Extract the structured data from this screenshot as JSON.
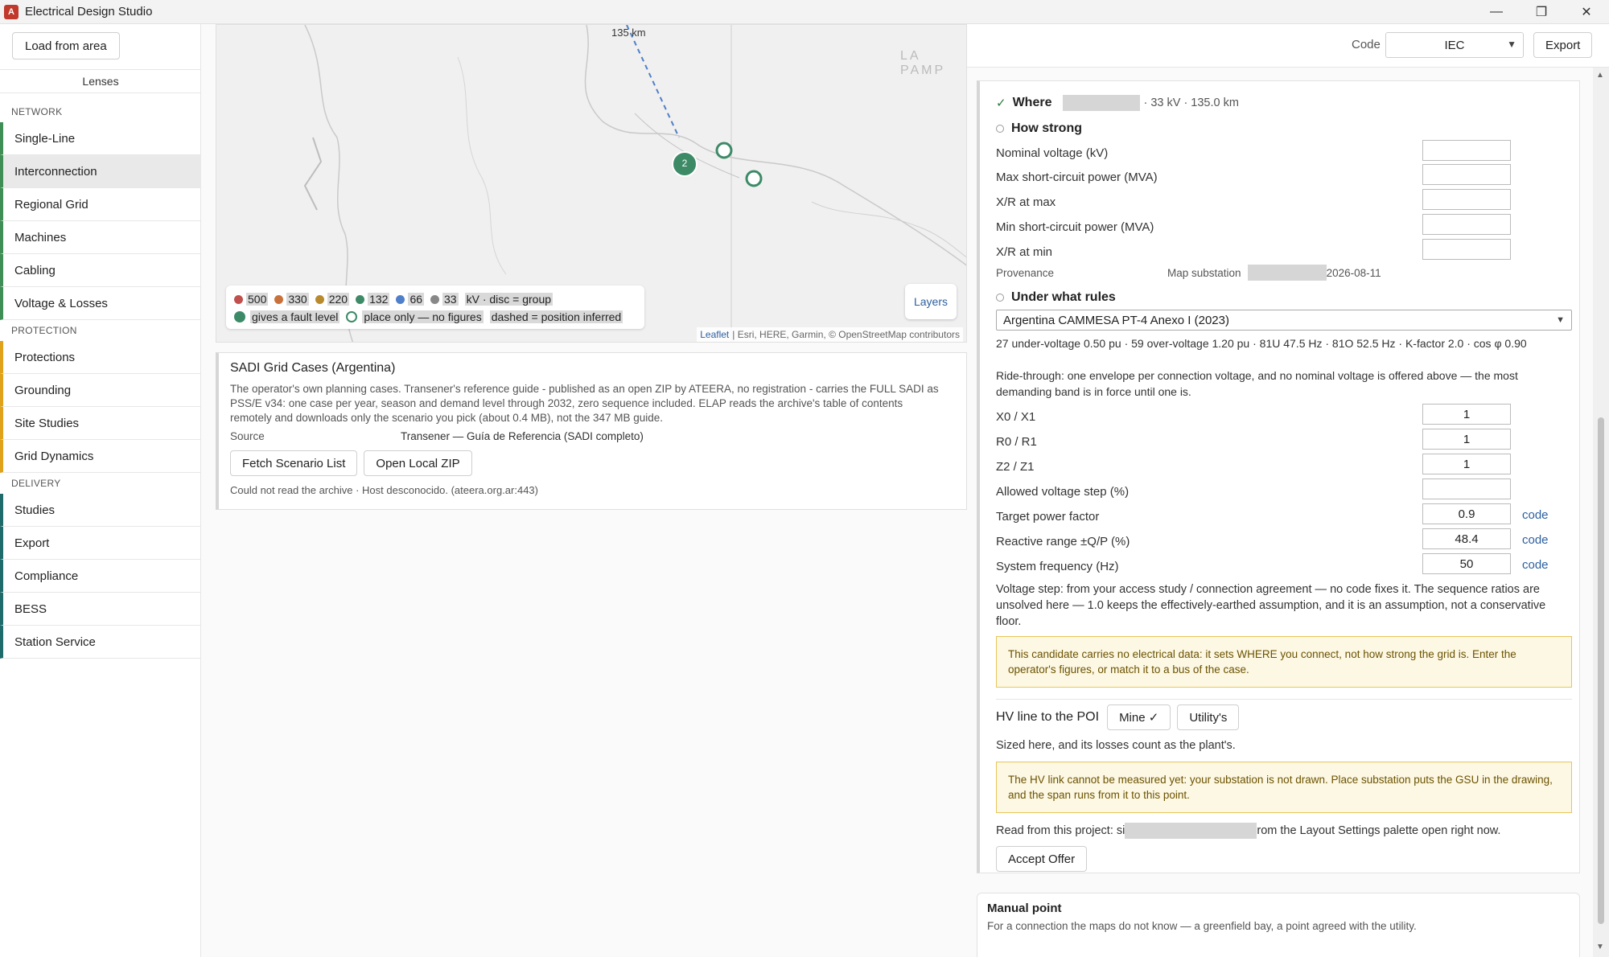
{
  "window": {
    "title": "Electrical Design Studio",
    "minimize": "—",
    "restore": "❐",
    "close": "✕"
  },
  "sidebar": {
    "load_button": "Load from area",
    "lenses_label": "Lenses",
    "sections": [
      {
        "label": "NETWORK",
        "items": [
          "Single-Line",
          "Interconnection",
          "Regional Grid",
          "Machines",
          "Cabling",
          "Voltage & Losses"
        ]
      },
      {
        "label": "PROTECTION",
        "items": [
          "Protections",
          "Grounding",
          "Site Studies",
          "Grid Dynamics"
        ]
      },
      {
        "label": "DELIVERY",
        "items": [
          "Studies",
          "Export",
          "Compliance",
          "BESS",
          "Station Service"
        ]
      }
    ],
    "active_item": "Interconnection"
  },
  "map": {
    "distance_label": "135 km",
    "region_label": "LA PAMP",
    "cluster_count": "2",
    "layers_button": "Layers",
    "attribution_leaflet": "Leaflet",
    "attribution_rest": "| Esri, HERE, Garmin, © OpenStreetMap contributors",
    "legend": {
      "voltages": [
        {
          "kv": "500",
          "color": "#c0504d"
        },
        {
          "kv": "330",
          "color": "#c9713a"
        },
        {
          "kv": "220",
          "color": "#b88a2e"
        },
        {
          "kv": "132",
          "color": "#3d8a67"
        },
        {
          "kv": "66",
          "color": "#4f7fc9"
        },
        {
          "kv": "33",
          "color": "#888888"
        }
      ],
      "unit_note": "kV · disc = group",
      "fault_level": "gives a fault level",
      "place_only": "place only — no figures",
      "dashed": "dashed = position inferred"
    }
  },
  "sadi": {
    "title": "SADI Grid Cases (Argentina)",
    "description": "The operator's own planning cases. Transener's reference guide - published as an open ZIP by ATEERA, no registration - carries the FULL SADI as PSS/E v34: one case per year, season and demand level through 2032, zero sequence included. ELAP reads the archive's table of contents remotely and downloads only the scenario you pick (about 0.4 MB), not the 347 MB guide.",
    "source_label": "Source",
    "source_value": "Transener — Guía de Referencia (SADI completo)",
    "fetch_button": "Fetch Scenario List",
    "open_button": "Open Local ZIP",
    "error": "Could not read the archive · Host desconocido. (ateera.org.ar:443)"
  },
  "header": {
    "code_label": "Code",
    "code_value": "IEC",
    "export_button": "Export"
  },
  "where": {
    "check": "✓",
    "title": "Where",
    "details": "· 33 kV · 135.0 km"
  },
  "how_strong": {
    "title": "How strong",
    "fields": [
      {
        "label": "Nominal voltage (kV)",
        "value": ""
      },
      {
        "label": "Max short-circuit power (MVA)",
        "value": ""
      },
      {
        "label": "X/R at max",
        "value": ""
      },
      {
        "label": "Min short-circuit power (MVA)",
        "value": ""
      },
      {
        "label": "X/R at min",
        "value": ""
      }
    ],
    "provenance_label": "Provenance",
    "provenance_source": "Map substation",
    "provenance_date": "2026-08-11"
  },
  "rules": {
    "title": "Under what rules",
    "selected": "Argentina CAMMESA PT-4 Anexo I (2023)",
    "summary": "27 under-voltage 0.50 pu · 59 over-voltage 1.20 pu · 81U 47.5 Hz · 81O 52.5 Hz · K-factor 2.0 · cos φ 0.90",
    "ride_through": "Ride-through: one envelope per connection voltage, and no nominal voltage is offered above — the most demanding band is in force until one is.",
    "fields": [
      {
        "label": "X0 / X1",
        "value": "1",
        "code": ""
      },
      {
        "label": "R0 / R1",
        "value": "1",
        "code": ""
      },
      {
        "label": "Z2 / Z1",
        "value": "1",
        "code": ""
      },
      {
        "label": "Allowed voltage step (%)",
        "value": "",
        "code": ""
      },
      {
        "label": "Target power factor",
        "value": "0.9",
        "code": "code"
      },
      {
        "label": "Reactive range ±Q/P (%)",
        "value": "48.4",
        "code": "code"
      },
      {
        "label": "System frequency (Hz)",
        "value": "50",
        "code": "code"
      }
    ],
    "voltage_step_note": "Voltage step: from your access study / connection agreement — no code fixes it. The sequence ratios are unsolved here — 1.0 keeps the effectively-earthed assumption, and it is an assumption, not a conservative floor.",
    "warning": "This candidate carries no electrical data: it sets WHERE you connect, not how strong the grid is. Enter the operator's figures, or match it to a bus of the case."
  },
  "hv_line": {
    "title": "HV line to the POI",
    "mine_button": "Mine ✓",
    "utility_button": "Utility's",
    "sized_note": "Sized here, and its losses count as the plant's.",
    "warning": "The HV link cannot be measured yet: your substation is not drawn. Place substation puts the GSU in the drawing, and the span runs from it to this point.",
    "read_prefix": "Read from this project: si",
    "read_suffix": "rom the Layout Settings palette open right now.",
    "accept_button": "Accept Offer"
  },
  "manual": {
    "title": "Manual point",
    "description": "For a connection the maps do not know — a greenfield bay, a point agreed with the utility."
  }
}
